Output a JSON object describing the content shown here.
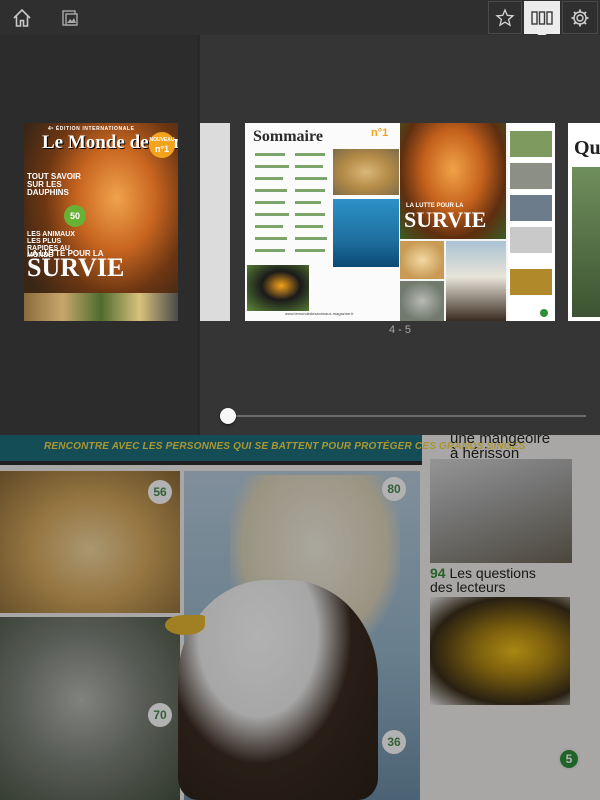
{
  "toolbar": {
    "home_icon": "home-icon",
    "gallery_icon": "gallery-icon",
    "star_icon": "star-icon",
    "pages_icon": "pages-grid-icon",
    "settings_icon": "gear-icon",
    "active_button": "pages"
  },
  "cover": {
    "edition": "4ᵉ ÉDITION INTERNATIONALE",
    "logo": "Le Monde des Animaux",
    "badge_top": "NOUVEAU",
    "badge_num": "n°1",
    "headline1": "TOUT SAVOIR SUR LES DAUPHINS",
    "headline2": "LES ANIMAUX LES PLUS RAPIDES AU MONDE",
    "badge50": "50",
    "headline3": "LA LUTTE POUR LA",
    "headline_big": "SURVIE"
  },
  "spread": {
    "title": "Sommaire",
    "issue": "n°1",
    "lutte": "LA LUTTE POUR LA",
    "survie": "SURVIE",
    "url": "www.lemondedesanimaux-magazine.fr"
  },
  "next_thumb": {
    "initial": "Qu"
  },
  "page_label": "4 - 5",
  "slider": {
    "position_fraction": 0.0
  },
  "background_page": {
    "banner": "RENCONTRE AVEC LES PERSONNES QUI SE BATTENT POUR PROTÉGER CES GRANDS SINGES",
    "badge_dog": "56",
    "badge_bear": "80",
    "badge_koala": "70",
    "badge_eagle": "36",
    "heading1_line1": "une mangeoire",
    "heading1_line2": "à hérisson",
    "heading2_num": "94",
    "heading2_line1": "Les questions",
    "heading2_line2": "des lecteurs",
    "page_number": "5"
  }
}
